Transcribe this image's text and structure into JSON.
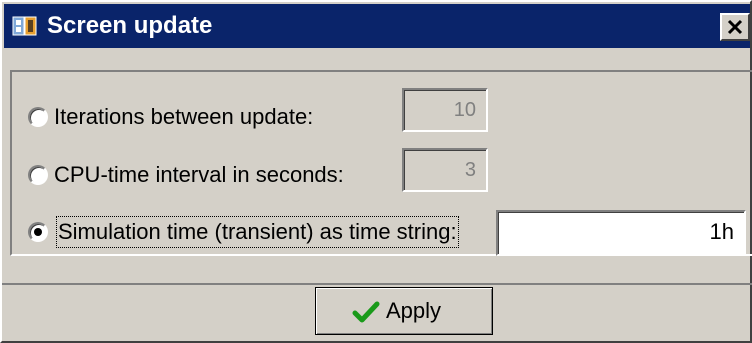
{
  "window": {
    "title": "Screen update"
  },
  "options": [
    {
      "label": "Iterations between update:",
      "value": "10",
      "selected": false,
      "enabled": false
    },
    {
      "label": "CPU-time interval in seconds:",
      "value": "3",
      "selected": false,
      "enabled": false
    },
    {
      "label": "Simulation time (transient) as time string:",
      "value": "1h",
      "selected": true,
      "enabled": true
    }
  ],
  "buttons": {
    "apply_label": "Apply"
  },
  "colors": {
    "titlebar": "#0a246a",
    "face": "#d4d0c8",
    "checkmark": "#1a9a1a"
  },
  "icons": {
    "title": "app-cube-icon",
    "close": "close-icon",
    "apply": "checkmark-icon"
  }
}
